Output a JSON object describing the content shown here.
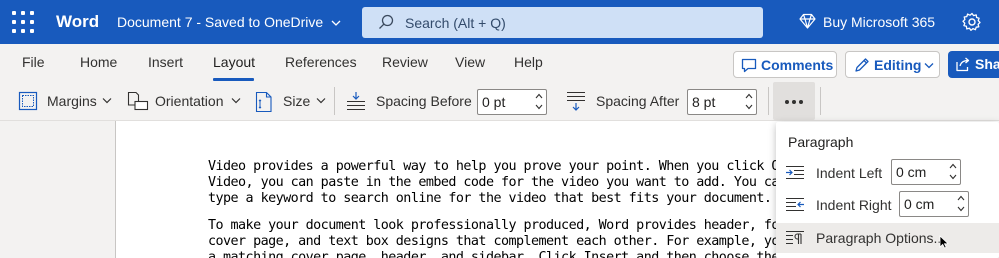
{
  "titlebar": {
    "app_name": "Word",
    "document_name": "Document 7  -  Saved to OneDrive",
    "search_placeholder": "Search (Alt + Q)",
    "buy_label": "Buy Microsoft 365"
  },
  "tabs": [
    "File",
    "Home",
    "Insert",
    "Layout",
    "References",
    "Review",
    "View",
    "Help"
  ],
  "active_tab": "Layout",
  "actions": {
    "comments_label": "Comments",
    "editing_label": "Editing",
    "share_label": "Share"
  },
  "ribbon": {
    "margins_label": "Margins",
    "orientation_label": "Orientation",
    "size_label": "Size",
    "spacing_before_label": "Spacing Before",
    "spacing_before_value": "0 pt",
    "spacing_after_label": "Spacing After",
    "spacing_after_value": "8 pt"
  },
  "document": {
    "paragraph1": [
      "Video provides a powerful way to help you prove your point. When you click Onli",
      "Video, you can paste in the embed code for the video you want to add. You can a",
      "type a keyword to search online for the video that best fits your document."
    ],
    "paragraph2": [
      "To make your document look professionally produced, Word provides header, foote",
      "cover page, and text box designs that complement each other. For example, you c",
      "a matching cover page, header, and sidebar. Click Insert and then choose the elements"
    ]
  },
  "paragraph_panel": {
    "title": "Paragraph",
    "indent_left_label": "Indent Left",
    "indent_left_value": "0 cm",
    "indent_right_label": "Indent Right",
    "indent_right_value": "0 cm",
    "options_label": "Paragraph Options..."
  },
  "colors": {
    "brand_blue": "#185abd",
    "ribbon_bg": "#f3f2f1",
    "search_bg": "#cfe0f6"
  }
}
